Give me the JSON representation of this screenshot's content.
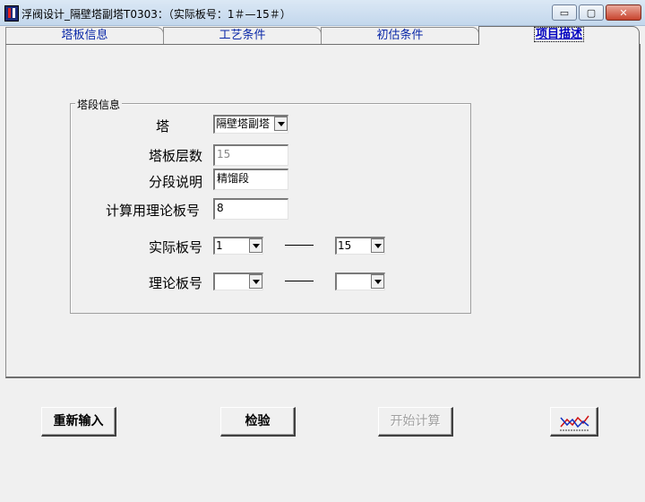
{
  "window": {
    "title": "浮阀设计_隔壁塔副塔T0303：（实际板号：1＃—15＃）",
    "controls": {
      "minimize": "▭",
      "maximize": "▢",
      "close": "✕"
    }
  },
  "tabs": [
    {
      "label": "塔板信息",
      "active": false
    },
    {
      "label": "工艺条件",
      "active": false
    },
    {
      "label": "初估条件",
      "active": false
    },
    {
      "label": "项目描述",
      "active": true
    }
  ],
  "group": {
    "title": "塔段信息",
    "tower_label": "塔",
    "tower_value": "隔壁塔副塔",
    "tray_count_label": "塔板层数",
    "tray_count_value": "15",
    "segment_desc_label": "分段说明",
    "segment_desc_value": "精馏段",
    "calc_tray_label": "计算用理论板号",
    "calc_tray_value": "8",
    "actual_tray_label": "实际板号",
    "actual_tray_from": "1",
    "actual_tray_to": "15",
    "theory_tray_label": "理论板号",
    "theory_tray_from": "",
    "theory_tray_to": ""
  },
  "buttons": {
    "reset": "重新输入",
    "check": "检验",
    "start": "开始计算"
  },
  "colors": {
    "tab_text": "#0a28a8",
    "chart_icon_line_red": "#d01010",
    "chart_icon_line_blue": "#1030c0"
  }
}
